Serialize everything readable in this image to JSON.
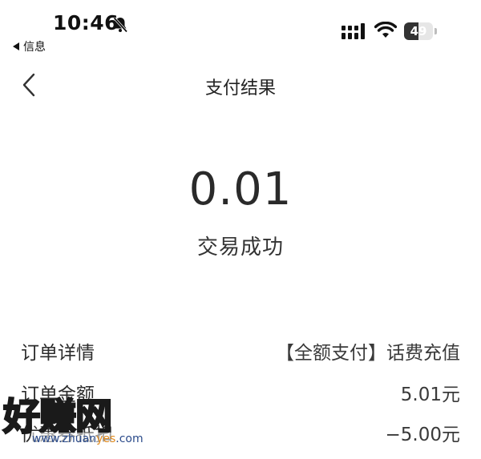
{
  "status_bar": {
    "time": "10:46",
    "back_app": "信息",
    "battery_level": "49",
    "battery_fraction": 0.49
  },
  "nav": {
    "title": "支付结果"
  },
  "result": {
    "amount": "0.01",
    "status": "交易成功"
  },
  "details": [
    {
      "label": "订单详情",
      "value": "【全额支付】话费充值"
    },
    {
      "label": "订单金额",
      "value": "5.01元"
    },
    {
      "label": "优惠券抵扣",
      "value": "−5.00元"
    }
  ],
  "watermark": {
    "brand": "好赚网",
    "url_prefix": "www.zhuan",
    "url_accent": "yes",
    "url_suffix": ".com"
  },
  "colors": {
    "text": "#222222",
    "watermark_url": "#2a4a8a",
    "watermark_accent": "#e08a1e"
  },
  "icons": [
    "bell-muted-icon",
    "signal-icon",
    "wifi-icon",
    "battery-icon",
    "back-chevron-icon"
  ]
}
